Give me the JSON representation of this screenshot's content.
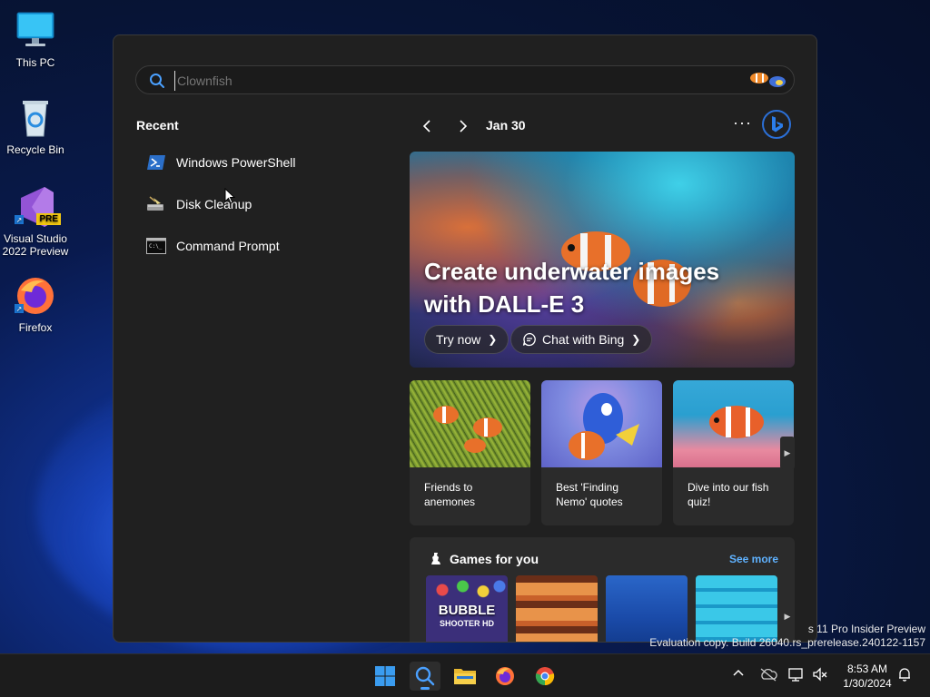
{
  "desktop": {
    "icons": [
      {
        "label": "This PC",
        "icon": "monitor-icon"
      },
      {
        "label": "Recycle Bin",
        "icon": "recycle-bin-icon"
      },
      {
        "label_line1": "Visual Studio",
        "label_line2": "2022 Preview",
        "badge": "PRE",
        "icon": "visual-studio-icon"
      },
      {
        "label": "Firefox",
        "icon": "firefox-icon"
      }
    ],
    "watermark": {
      "line1": "s 11 Pro Insider Preview",
      "line2": "Evaluation copy. Build 26040.rs_prerelease.240122-1157"
    }
  },
  "search": {
    "placeholder": "Clownfish",
    "value": ""
  },
  "recent": {
    "title": "Recent",
    "items": [
      {
        "label": "Windows PowerShell",
        "icon": "powershell-icon"
      },
      {
        "label": "Disk Cleanup",
        "icon": "disk-cleanup-icon"
      },
      {
        "label": "Command Prompt",
        "icon": "command-prompt-icon"
      }
    ]
  },
  "highlights": {
    "date": "Jan 30",
    "more": "···",
    "hero": {
      "title": "Create underwater images with DALL-E 3",
      "buttons": [
        {
          "label": "Try now"
        },
        {
          "label": "Chat with Bing"
        }
      ]
    },
    "cards": [
      {
        "line1": "Friends to",
        "line2": "anemones"
      },
      {
        "line1": "Best 'Finding",
        "line2": "Nemo' quotes"
      },
      {
        "line1": "Dive into our fish",
        "line2": "quiz!"
      }
    ],
    "games": {
      "title": "Games for you",
      "see_more": "See more",
      "tiles": [
        {
          "label_line1": "BUBBLE",
          "label_line2": "SHOOTER HD"
        }
      ]
    }
  },
  "taskbar": {
    "time": "8:53 AM",
    "date": "1/30/2024",
    "accent": "#4aa0ff"
  }
}
